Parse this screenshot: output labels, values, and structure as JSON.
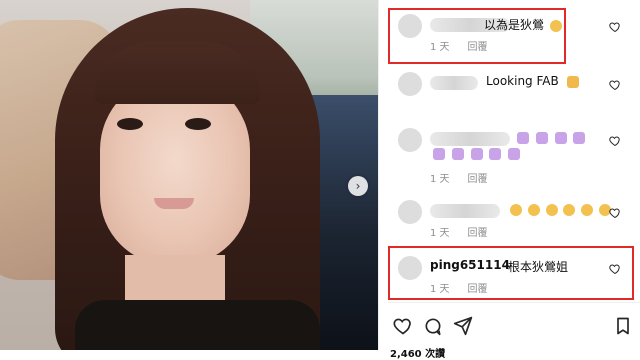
{
  "post": {
    "photo": {
      "alt": ""
    }
  },
  "comments": [
    {
      "text": "以為是狄鶯",
      "time": "1 天",
      "reply_label": "回覆",
      "highlighted": true,
      "username_blurred": true,
      "emoji": "grinning"
    },
    {
      "text": "Looking FAB",
      "time": "",
      "reply_label": "",
      "highlighted": false,
      "username_blurred": true,
      "emoji": "waving-hands"
    },
    {
      "text": "",
      "time": "1 天",
      "reply_label": "回覆",
      "highlighted": false,
      "username_blurred": true,
      "emoji": "crowns"
    },
    {
      "text": "",
      "time": "1 天",
      "reply_label": "回覆",
      "highlighted": false,
      "username_blurred": true,
      "emoji": "smiling-faces"
    },
    {
      "username": "ping651114",
      "text": "根本狄鶯姐",
      "time": "1 天",
      "reply_label": "回覆",
      "highlighted": true,
      "username_blurred": false,
      "emoji": ""
    }
  ],
  "toolbar": {
    "likes_text": "2,460 次讚"
  },
  "colors": {
    "highlight": "#e02a2a",
    "meta_text": "#8e8e8e"
  }
}
